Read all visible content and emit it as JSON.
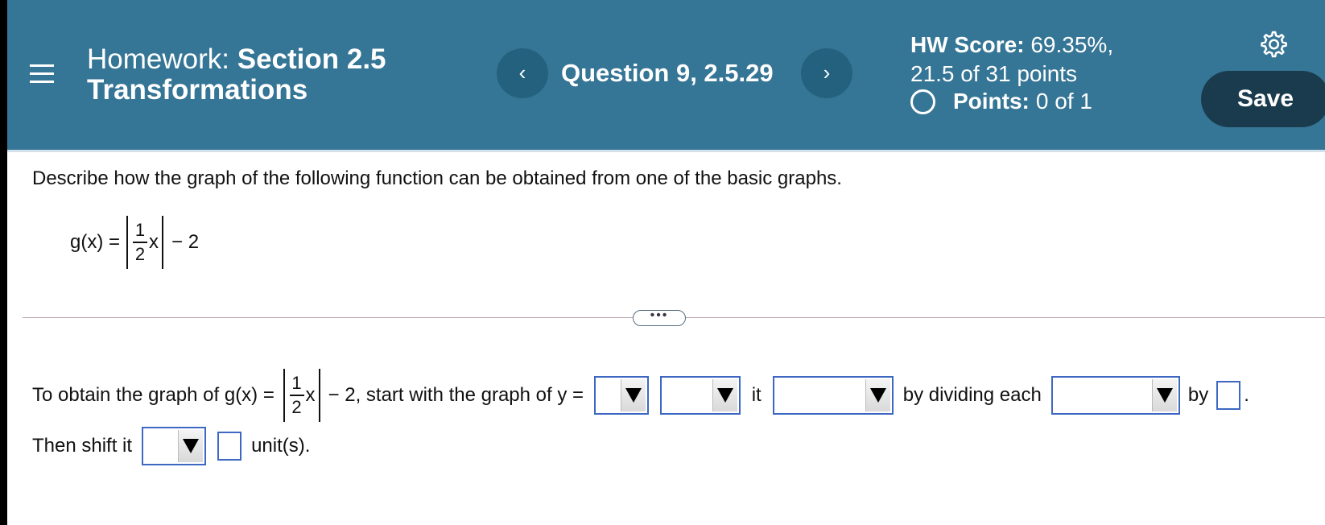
{
  "header": {
    "hw_prefix": "Homework:",
    "hw_title_bold": "Section 2.5",
    "hw_title_line2": "Transformations",
    "question_label": "Question 9, 2.5.29",
    "prev_label": "‹",
    "next_label": "›",
    "score_label": "HW Score:",
    "score_value": "69.35%,",
    "score_points": "21.5 of 31 points",
    "points_label": "Points:",
    "points_value": "0 of 1",
    "save_label": "Save"
  },
  "question": {
    "instruction": "Describe how the graph of the following function can be obtained from one of the basic graphs.",
    "fn_lhs": "g(x) =",
    "frac_num": "1",
    "frac_den": "2",
    "fn_var": "x",
    "fn_tail": "− 2"
  },
  "answer": {
    "lead": "To obtain the graph of g(x) = ",
    "frac_num": "1",
    "frac_den": "2",
    "fn_var": "x",
    "after_fn": "− 2, start with the graph of y = ",
    "word_it": "it",
    "word_by_dividing": "by dividing each",
    "word_by": "by",
    "period": ".",
    "row2_lead": "Then shift it",
    "row2_tail": "unit(s)."
  },
  "colors": {
    "header_bg": "#357595",
    "save_bg": "#1a3b4d",
    "input_border": "#3d67c2"
  },
  "icons": {
    "menu": "hamburger-menu-icon",
    "settings": "gear-icon",
    "status": "empty-circle-icon"
  }
}
